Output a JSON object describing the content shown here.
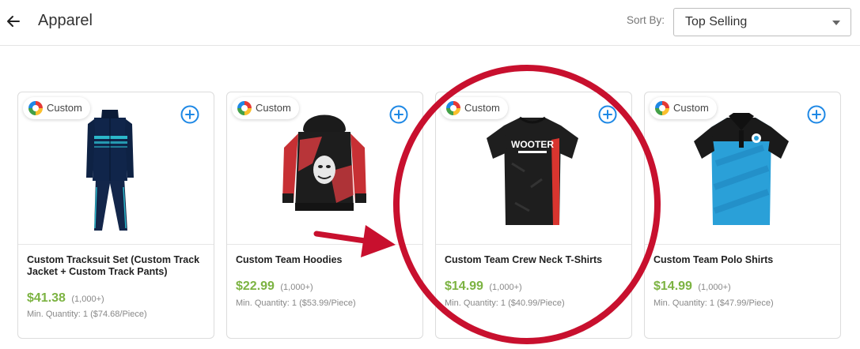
{
  "header": {
    "title": "Apparel",
    "sort_label": "Sort By:",
    "sort_value": "Top Selling"
  },
  "badge_label": "Custom",
  "products": [
    {
      "name": "Custom Tracksuit Set (Custom Track Jacket + Custom Track Pants)",
      "price": "$41.38",
      "qty": "(1,000+)",
      "min_qty": "Min. Quantity: 1 ($74.68/Piece)"
    },
    {
      "name": "Custom Team Hoodies",
      "price": "$22.99",
      "qty": "(1,000+)",
      "min_qty": "Min. Quantity: 1 ($53.99/Piece)"
    },
    {
      "name": "Custom Team Crew Neck T-Shirts",
      "price": "$14.99",
      "qty": "(1,000+)",
      "min_qty": "Min. Quantity: 1 ($40.99/Piece)",
      "shirt_print": "WOOTER"
    },
    {
      "name": "Custom Team Polo Shirts",
      "price": "$14.99",
      "qty": "(1,000+)",
      "min_qty": "Min. Quantity: 1 ($47.99/Piece)"
    }
  ],
  "colors": {
    "price_green": "#7cb342",
    "accent_blue": "#1e88e5",
    "annotation_red": "#c8102e"
  },
  "icons": [
    "back-arrow-icon",
    "chevron-down-icon",
    "custom-color-icon",
    "add-circle-icon"
  ]
}
